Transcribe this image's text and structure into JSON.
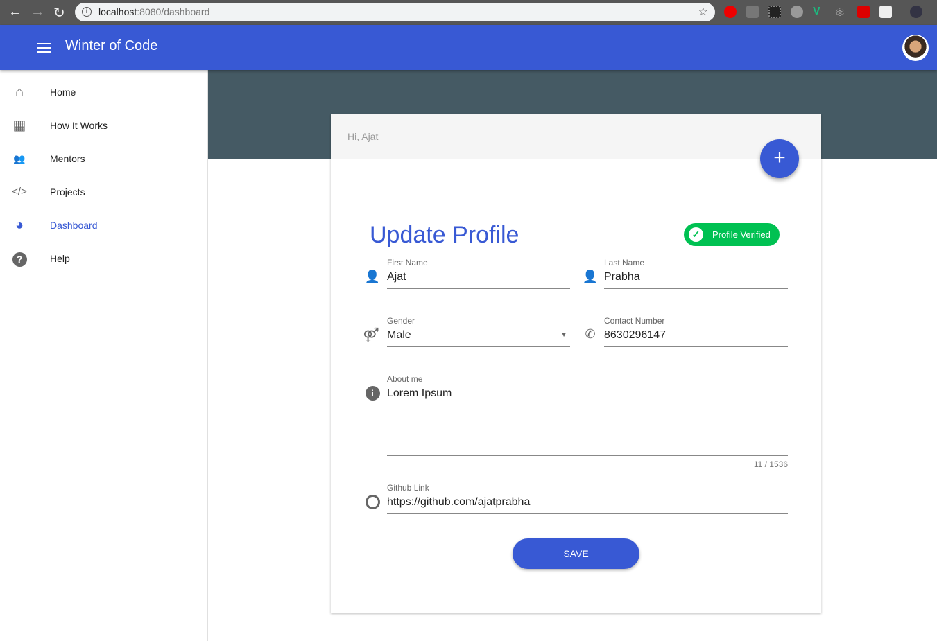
{
  "browser": {
    "url_host": "localhost",
    "url_rest": ":8080/dashboard"
  },
  "appbar": {
    "title": "Winter of Code"
  },
  "sidebar": {
    "items": [
      {
        "label": "Home",
        "icon": "home-icon"
      },
      {
        "label": "How It Works",
        "icon": "calendar-icon"
      },
      {
        "label": "Mentors",
        "icon": "people-icon"
      },
      {
        "label": "Projects",
        "icon": "code-icon"
      },
      {
        "label": "Dashboard",
        "icon": "dashboard-icon",
        "active": true
      },
      {
        "label": "Help",
        "icon": "help-icon"
      }
    ]
  },
  "card": {
    "greeting": "Hi, Ajat",
    "fab": "+",
    "heading": "Update Profile",
    "badge": "Profile Verified",
    "first_name": {
      "label": "First Name",
      "value": "Ajat"
    },
    "last_name": {
      "label": "Last Name",
      "value": "Prabha"
    },
    "gender": {
      "label": "Gender",
      "value": "Male"
    },
    "contact": {
      "label": "Contact Number",
      "value": "8630296147"
    },
    "about": {
      "label": "About me",
      "value": "Lorem Ipsum",
      "counter": "11 / 1536"
    },
    "github": {
      "label": "Github Link",
      "value": "https://github.com/ajatprabha"
    },
    "save": "SAVE"
  },
  "colors": {
    "primary": "#3859d4",
    "banner": "#455a64",
    "verified": "#00c152"
  }
}
